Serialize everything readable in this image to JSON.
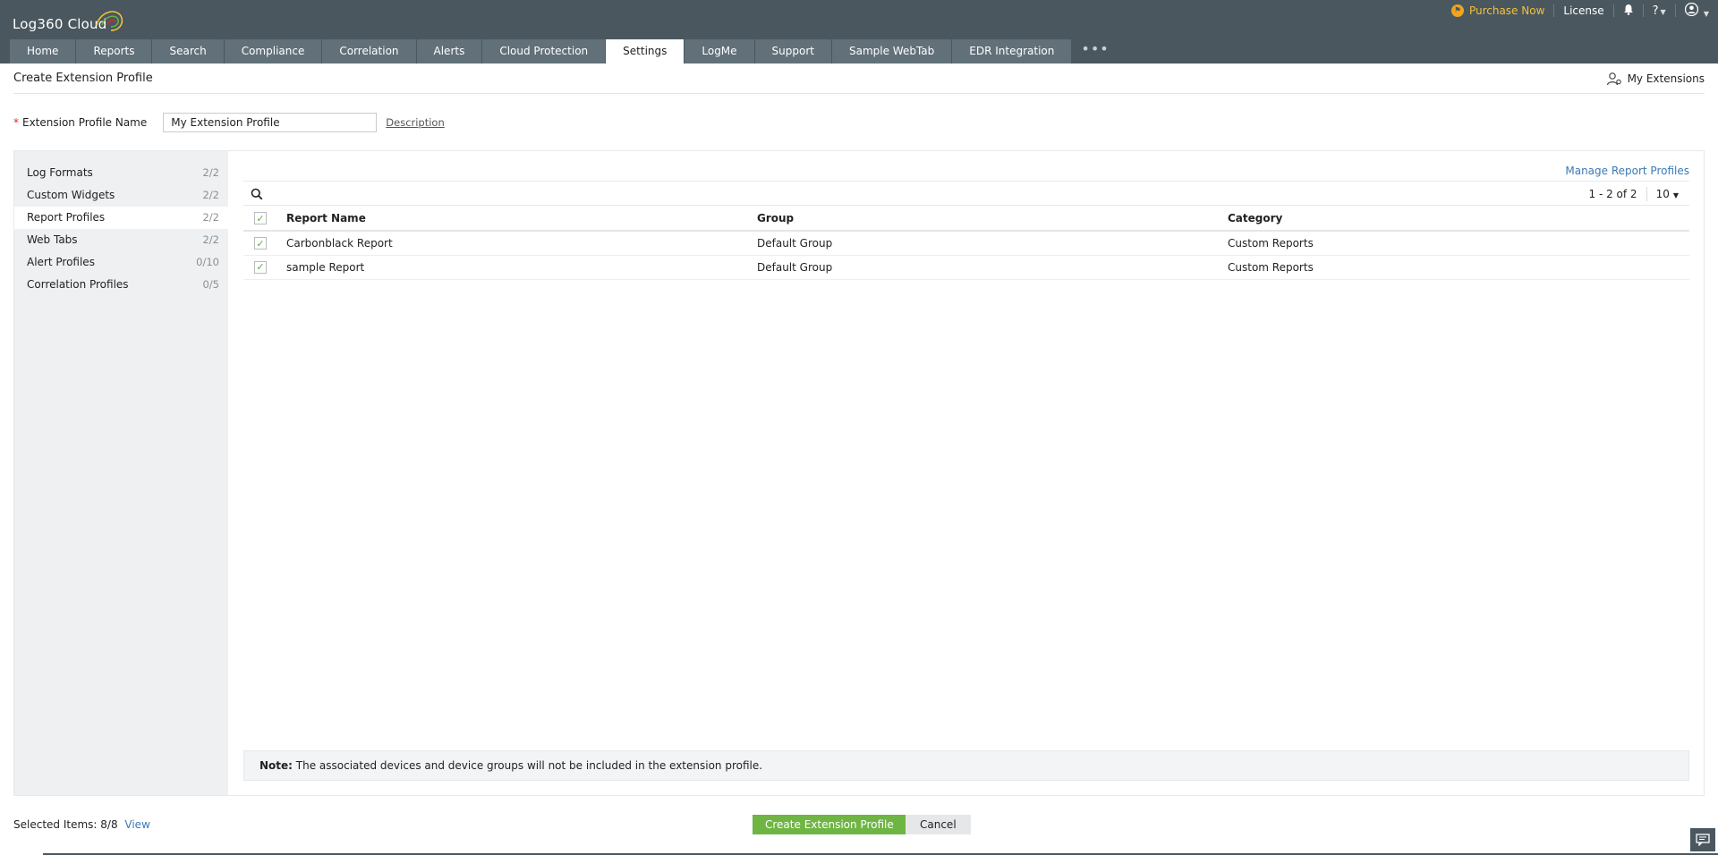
{
  "app": {
    "name": "Log360 Cloud"
  },
  "utility": {
    "purchase": "Purchase Now",
    "license": "License"
  },
  "tabs": [
    {
      "label": "Home"
    },
    {
      "label": "Reports"
    },
    {
      "label": "Search"
    },
    {
      "label": "Compliance"
    },
    {
      "label": "Correlation"
    },
    {
      "label": "Alerts"
    },
    {
      "label": "Cloud Protection"
    },
    {
      "label": "Settings",
      "active": true
    },
    {
      "label": "LogMe"
    },
    {
      "label": "Support"
    },
    {
      "label": "Sample WebTab"
    },
    {
      "label": "EDR Integration"
    }
  ],
  "page": {
    "title": "Create Extension Profile",
    "my_extensions": "My Extensions"
  },
  "form": {
    "required_mark": "*",
    "profile_name_label": "Extension Profile Name",
    "profile_name_value": "My Extension Profile",
    "description_link": "Description"
  },
  "sidebar": {
    "items": [
      {
        "label": "Log Formats",
        "count": "2/2"
      },
      {
        "label": "Custom Widgets",
        "count": "2/2"
      },
      {
        "label": "Report Profiles",
        "count": "2/2",
        "active": true
      },
      {
        "label": "Web Tabs",
        "count": "2/2"
      },
      {
        "label": "Alert Profiles",
        "count": "0/10"
      },
      {
        "label": "Correlation Profiles",
        "count": "0/5"
      }
    ]
  },
  "content": {
    "manage_link": "Manage Report Profiles",
    "pagination": "1 - 2 of 2",
    "page_size": "10",
    "columns": [
      "Report Name",
      "Group",
      "Category"
    ],
    "rows": [
      {
        "name": "Carbonblack Report",
        "group": "Default Group",
        "category": "Custom Reports",
        "checked": true
      },
      {
        "name": "sample Report",
        "group": "Default Group",
        "category": "Custom Reports",
        "checked": true
      }
    ],
    "note_label": "Note:",
    "note_text": " The associated devices and device groups will not be included in the extension profile."
  },
  "footer": {
    "selected_label": "Selected Items: 8/8",
    "view_link": "View",
    "create_button": "Create Extension Profile",
    "cancel_button": "Cancel"
  },
  "colors": {
    "header_bg": "#4a575f",
    "tab_bg": "#617079",
    "link": "#3b79b6",
    "primary_button": "#6fb544",
    "purchase": "#f2c13b"
  }
}
